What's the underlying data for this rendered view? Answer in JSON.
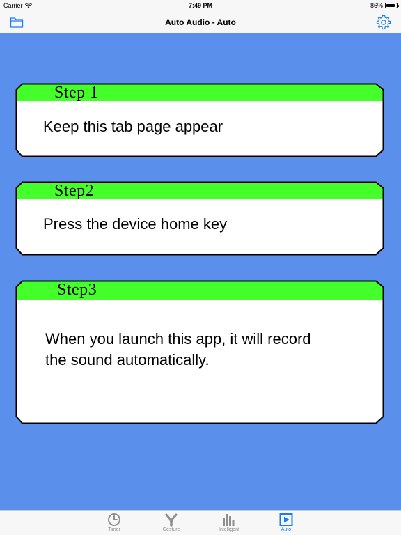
{
  "status_bar": {
    "carrier": "Carrier",
    "time": "7:49 PM",
    "battery_percent_text": "86%",
    "battery_level": 0.86
  },
  "nav": {
    "title": "Auto Audio - Auto",
    "left_icon": "folder-icon",
    "right_icon": "gear-icon"
  },
  "colors": {
    "background": "#5b8fec",
    "step_header": "#44ff2a",
    "accent": "#1a7cf5"
  },
  "steps": [
    {
      "label": "Step  1",
      "text": "Keep this tab page appear"
    },
    {
      "label": "Step2",
      "text": "Press the device home key"
    },
    {
      "label": "Step3",
      "text": "When you launch this app, it will record the sound automatically."
    }
  ],
  "tabs": [
    {
      "label": "Timer",
      "icon": "clock-icon",
      "active": false
    },
    {
      "label": "Gesture",
      "icon": "gesture-icon",
      "active": false
    },
    {
      "label": "Intelligent",
      "icon": "bar-chart-icon",
      "active": false
    },
    {
      "label": "Auto",
      "icon": "play-icon",
      "active": true
    }
  ]
}
